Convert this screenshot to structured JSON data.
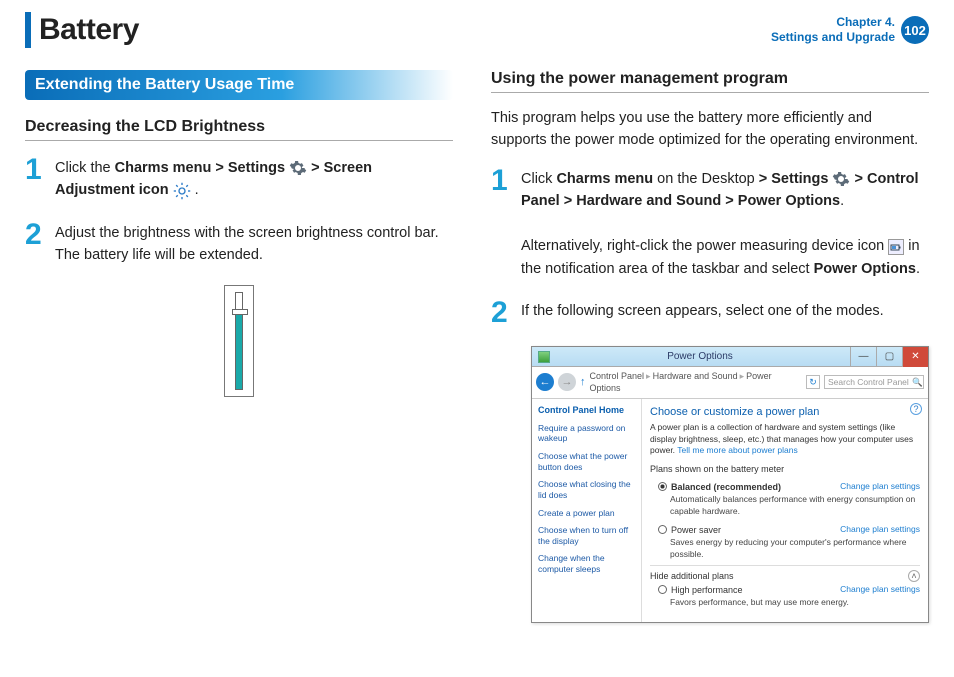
{
  "header": {
    "title": "Battery",
    "chapter_line1": "Chapter 4.",
    "chapter_line2": "Settings and Upgrade",
    "page_number": "102"
  },
  "left": {
    "section_title": "Extending the Battery Usage Time",
    "h3": "Decreasing the LCD Brightness",
    "step1": {
      "num": "1",
      "t1": "Click the ",
      "b1": "Charms menu",
      "g1": " > ",
      "b2": "Settings",
      "g2": " > ",
      "b3": "Screen Adjustment icon",
      "tail": " ."
    },
    "step2": {
      "num": "2",
      "text": "Adjust the brightness with the screen brightness control bar. The battery life will be extended."
    }
  },
  "right": {
    "h3": "Using the power management program",
    "intro": "This program helps you use the battery more efficiently and supports the power mode optimized for the operating environment.",
    "step1": {
      "num": "1",
      "t1": "Click ",
      "b1": "Charms menu",
      "t2": " on the Desktop ",
      "g1": "> ",
      "b2": "Settings",
      "g2": " > ",
      "b3": "Control Panel",
      "g3": " > ",
      "b4": "Hardware and Sound",
      "g4": " > ",
      "b5": "Power Options",
      "tail": ".",
      "alt1": "Alternatively, right-click the power measuring device icon ",
      "alt2": " in the notification area of the taskbar and select ",
      "b6": "Power Options",
      "tail2": "."
    },
    "step2": {
      "num": "2",
      "text": "If the following screen appears, select one of the modes."
    }
  },
  "shot": {
    "title": "Power Options",
    "min": "—",
    "max": "▢",
    "close": "✕",
    "back": "←",
    "fwd": "→",
    "up": "↑",
    "bc1": "Control Panel",
    "bc2": "Hardware and Sound",
    "bc3": "Power Options",
    "refresh": "↻",
    "search": "Search Control Panel",
    "search_glyph": "🔍",
    "help": "?",
    "side": {
      "home": "Control Panel Home",
      "s1": "Require a password on wakeup",
      "s2": "Choose what the power button does",
      "s3": "Choose what closing the lid does",
      "s4": "Create a power plan",
      "s5": "Choose when to turn off the display",
      "s6": "Change when the computer sleeps"
    },
    "main": {
      "head": "Choose or customize a power plan",
      "desc1": "A power plan is a collection of hardware and system settings (like display brightness, sleep, etc.) that manages how your computer uses power. ",
      "desc_link": "Tell me more about power plans",
      "subhead": "Plans shown on the battery meter",
      "p1_name": "Balanced (recommended)",
      "p1_sub": "Automatically balances performance with energy consumption on capable hardware.",
      "p2_name": "Power saver",
      "p2_sub": "Saves energy by reducing your computer's performance where possible.",
      "hide": "Hide additional plans",
      "exp": "˄",
      "p3_name": "High performance",
      "p3_sub": "Favors performance, but may use more energy.",
      "cps": "Change plan settings"
    }
  }
}
